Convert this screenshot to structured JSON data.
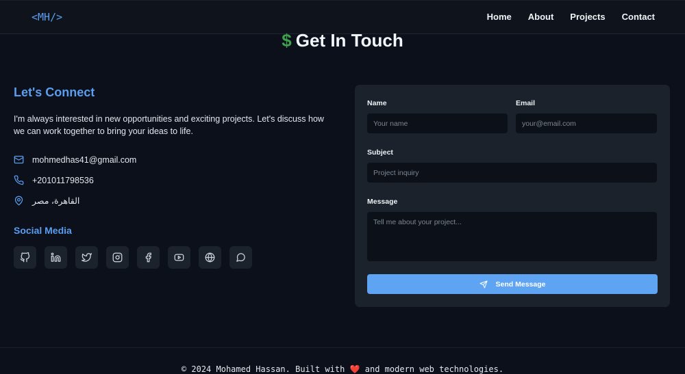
{
  "nav": {
    "logo": "<MH/>",
    "links": [
      "Home",
      "About",
      "Projects",
      "Contact"
    ]
  },
  "section": {
    "title_symbol": "$",
    "title": "Get In Touch"
  },
  "connect": {
    "heading": "Let's Connect",
    "description": "I'm always interested in new opportunities and exciting projects. Let's discuss how we can work together to bring your ideas to life.",
    "email": "mohmedhas41@gmail.com",
    "phone": "+201011798536",
    "location": "القاهرة، مصر"
  },
  "social": {
    "heading": "Social Media",
    "icons": [
      "github-icon",
      "linkedin-icon",
      "twitter-icon",
      "instagram-icon",
      "facebook-icon",
      "youtube-icon",
      "globe-icon",
      "chat-icon"
    ]
  },
  "form": {
    "name_label": "Name",
    "name_placeholder": "Your name",
    "email_label": "Email",
    "email_placeholder": "your@email.com",
    "subject_label": "Subject",
    "subject_placeholder": "Project inquiry",
    "message_label": "Message",
    "message_placeholder": "Tell me about your project...",
    "submit_label": "Send Message"
  },
  "footer": {
    "text_before": "© 2024 Mohamed Hassan. Built with",
    "heart": "❤️",
    "text_after": "and modern web technologies."
  },
  "colors": {
    "background": "#0b101a",
    "accent": "#5b9ef0",
    "card": "#1b222c",
    "button": "#5ea4f3",
    "dollar": "#3fa04d"
  }
}
